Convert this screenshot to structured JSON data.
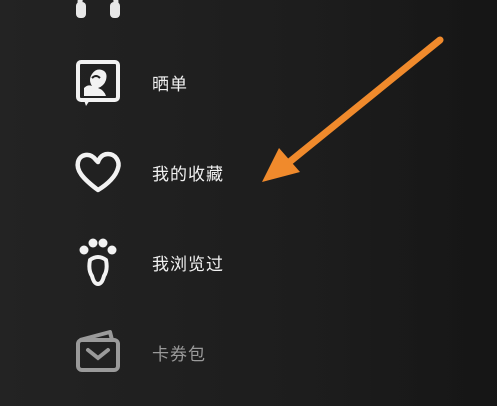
{
  "menu": {
    "items": [
      {
        "label": "",
        "icon": "headset-icon"
      },
      {
        "label": "晒单",
        "icon": "photo-share-icon"
      },
      {
        "label": "我的收藏",
        "icon": "heart-icon"
      },
      {
        "label": "我浏览过",
        "icon": "footprint-icon"
      },
      {
        "label": "卡券包",
        "icon": "wallet-icon"
      }
    ]
  },
  "annotation": {
    "arrow_color": "#f08a2c",
    "points_to": "我的收藏"
  }
}
